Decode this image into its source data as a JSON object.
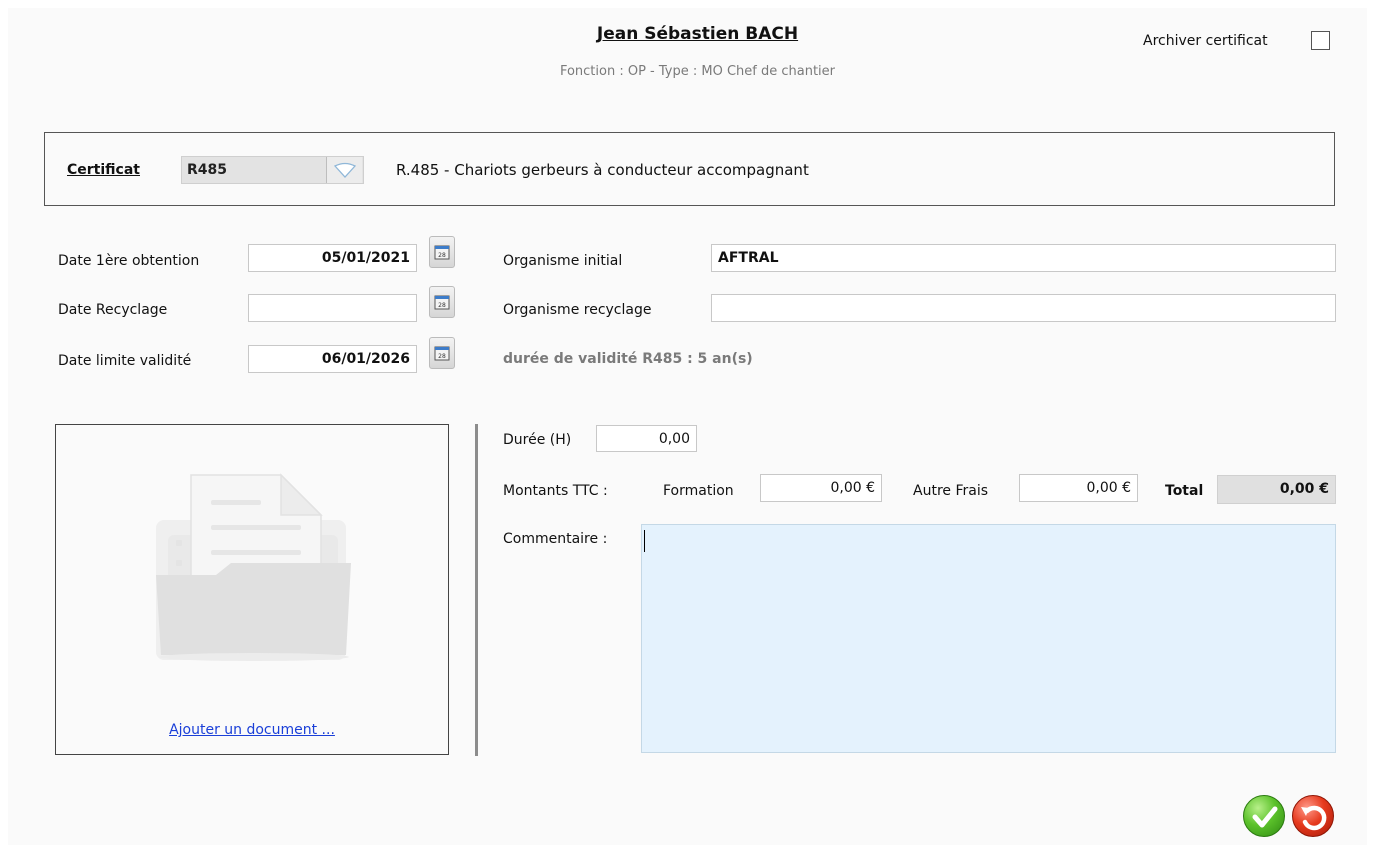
{
  "header": {
    "person_name": "Jean Sébastien BACH",
    "subtitle": "Fonction : OP - Type : MO Chef de chantier",
    "archive_label": "Archiver certificat",
    "archive_checked": false
  },
  "certificate": {
    "label": "Certificat",
    "code": "R485",
    "description": "R.485 - Chariots gerbeurs à conducteur accompagnant"
  },
  "dates": {
    "first_label": "Date 1ère obtention",
    "first_value": "05/01/2021",
    "recycle_label": "Date Recyclage",
    "recycle_value": "",
    "limit_label": "Date limite validité",
    "limit_value": "06/01/2026"
  },
  "organisms": {
    "initial_label": "Organisme initial",
    "initial_value": "AFTRAL",
    "recycle_label": "Organisme recyclage",
    "recycle_value": ""
  },
  "validity_text": "durée de validité R485 : 5 an(s)",
  "document": {
    "add_link": "Ajouter un document ..."
  },
  "costs": {
    "duration_label": "Durée (H)",
    "duration_value": "0,00",
    "amounts_label": "Montants TTC :",
    "training_label": "Formation",
    "training_value": "0,00 €",
    "other_label": "Autre Frais",
    "other_value": "0,00 €",
    "total_label": "Total",
    "total_value": "0,00 €"
  },
  "comment": {
    "label": "Commentaire :",
    "value": ""
  },
  "colors": {
    "link": "#1a3fd8",
    "comment_bg": "#e4f2fd",
    "ok_green": "#5cc22b",
    "cancel_red": "#e63a1e"
  }
}
